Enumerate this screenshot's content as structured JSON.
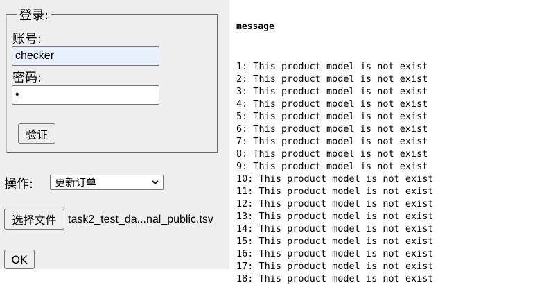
{
  "login": {
    "legend": "登录:",
    "account_label": "账号:",
    "account_value": "checker",
    "password_label": "密码:",
    "password_value": "•",
    "verify_button": "验证"
  },
  "operation": {
    "label": "操作:",
    "selected": "更新订单"
  },
  "file": {
    "choose_button": "选择文件",
    "file_name": "task2_test_da...nal_public.tsv"
  },
  "ok_button": "OK",
  "message": {
    "title": "message",
    "lines": [
      "1: This product model is not exist",
      "2: This product model is not exist",
      "3: This product model is not exist",
      "4: This product model is not exist",
      "5: This product model is not exist",
      "6: This product model is not exist",
      "7: This product model is not exist",
      "8: This product model is not exist",
      "9: This product model is not exist",
      "10: This product model is not exist",
      "11: This product model is not exist",
      "12: This product model is not exist",
      "13: This product model is not exist",
      "14: This product model is not exist",
      "15: This product model is not exist",
      "16: This product model is not exist",
      "17: This product model is not exist",
      "18: This product model is not exist"
    ]
  },
  "colors": {
    "panel_bg": "#eeeeee",
    "autofill_bg": "#e8f0fe",
    "button_bg": "#efefef"
  },
  "icons": {
    "select_arrow": "chevron-down-icon"
  }
}
